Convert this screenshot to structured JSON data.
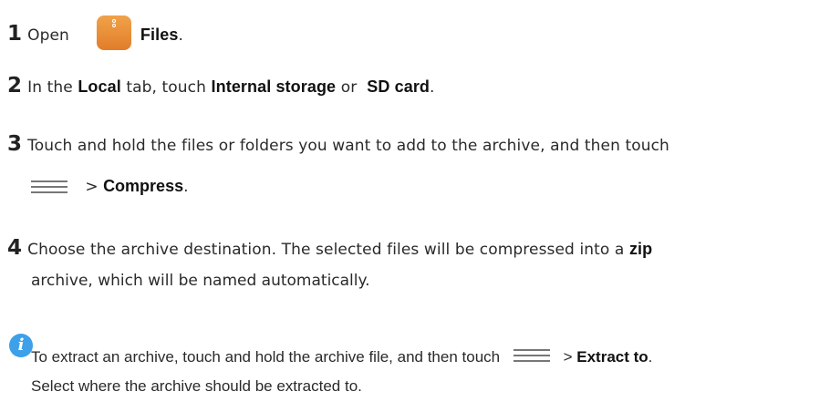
{
  "steps": [
    {
      "num": "1",
      "pre": "Open",
      "bold": "Files",
      "post": "."
    },
    {
      "num": "2",
      "pre": "In the",
      "local": "Local",
      "mid": "tab, touch",
      "internal": "Internal storage",
      "or": "or",
      "sd": "SD card",
      "post": "."
    },
    {
      "num": "3",
      "line1": "Touch and hold the files or folders you want to add to the archive, and then touch",
      "sep": ">",
      "bold": "Compress",
      "post": "."
    },
    {
      "num": "4",
      "line1a": "Choose the archive destination. The selected files will be compressed into a",
      "zip": "zip",
      "line2": "archive, which will be named automatically."
    }
  ],
  "note": {
    "line1a": "To extract an archive, touch and hold the archive file, and then touch",
    "sep": ">",
    "bold": "Extract to",
    "post": ".",
    "line2": "Select where the archive should be extracted to."
  },
  "icons": {
    "files": "files-app-icon",
    "menu": "menu-icon",
    "info": "info-icon"
  },
  "colors": {
    "files_icon": "#e8892f",
    "info_icon": "#3da0e8"
  }
}
